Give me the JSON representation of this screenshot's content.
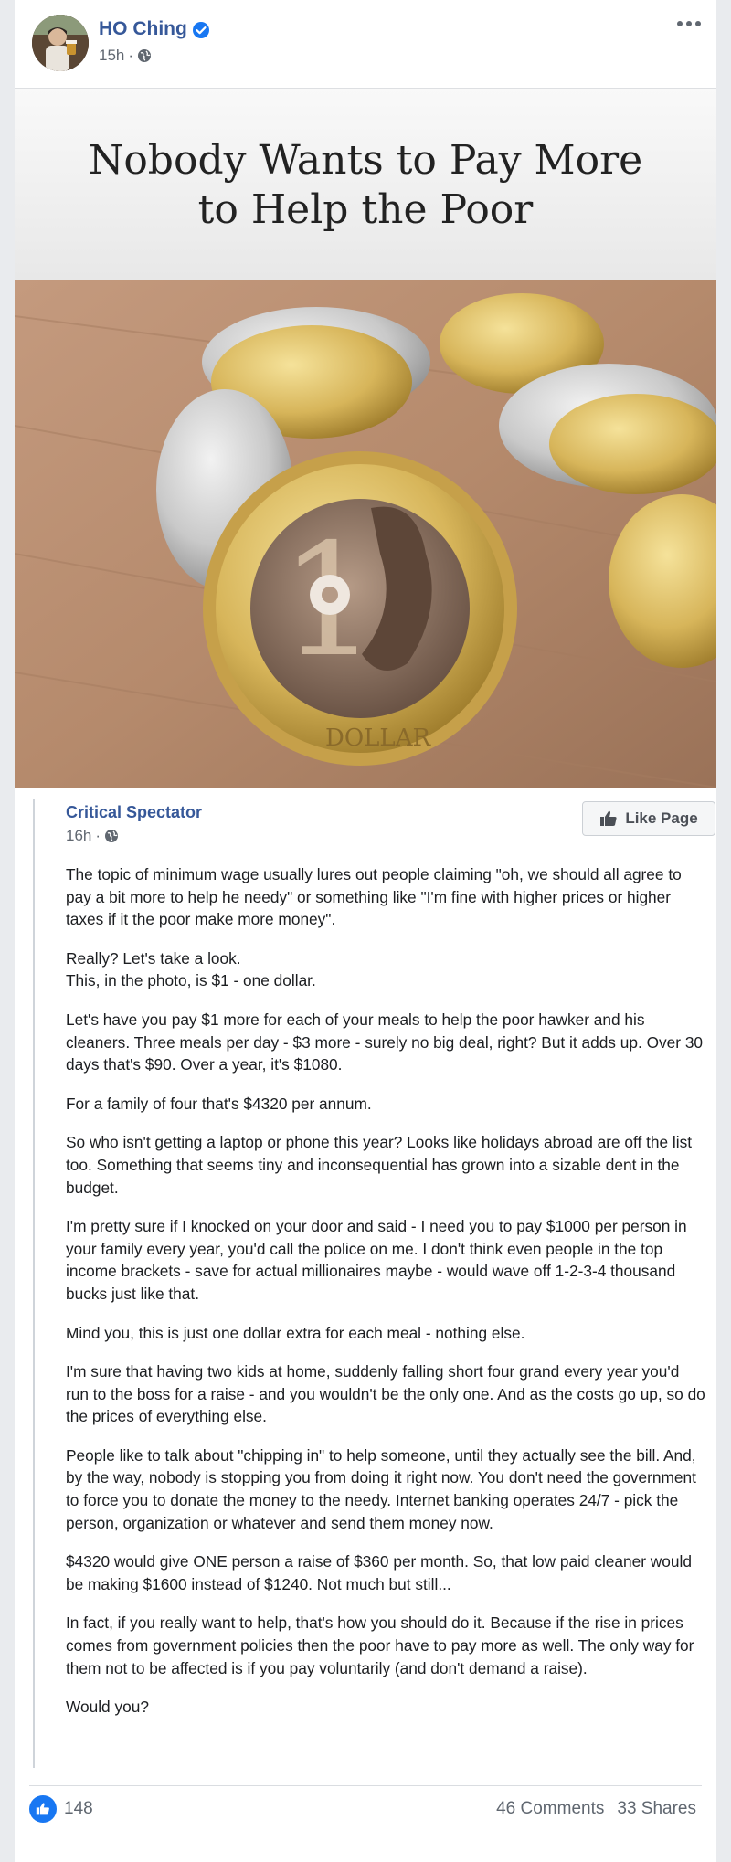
{
  "post": {
    "author": "HO Ching",
    "time": "15h",
    "menu_icon": "more-options-icon"
  },
  "image": {
    "headline_line1": "Nobody Wants to Pay More",
    "headline_line2": "to Help the Poor",
    "coin_text": "DOLLAR",
    "coin_numeral": "1"
  },
  "shared": {
    "page_name": "Critical Spectator",
    "time": "16h",
    "like_page_label": "Like Page",
    "paragraphs": [
      "The topic of minimum wage usually lures out people claiming \"oh, we should all agree to pay a bit more to help he needy\" or something like \"I'm fine with higher prices or higher taxes if it the poor make more money\".",
      "Really? Let's take a look.\nThis, in the photo, is $1 - one dollar.",
      "Let's have you pay $1 more for each of your meals to help the poor hawker and his cleaners. Three meals per day - $3 more - surely no big deal, right? But it adds up. Over 30 days that's $90. Over a year, it's $1080.",
      "For a family of four that's $4320 per annum.",
      "So who isn't getting a laptop or phone this year? Looks like holidays abroad are off the list too. Something that seems tiny and inconsequential has grown into a sizable dent in the budget.",
      "I'm pretty sure if I knocked on your door and said - I need you to pay $1000 per person in your family every year, you'd call the police on me. I don't think even people in the top income brackets - save for actual millionaires maybe - would wave off 1-2-3-4 thousand bucks just like that.",
      "Mind you, this is just one dollar extra for each meal - nothing else.",
      "I'm sure that having two kids at home, suddenly falling short four grand every year you'd run to the boss for a raise - and you wouldn't be the only one. And as the costs go up, so do the prices of everything else.",
      "People like to talk about \"chipping in\" to help someone, until they actually see the bill. And, by the way, nobody is stopping you from doing it right now. You don't need the government to force you to donate the money to the needy. Internet banking operates 24/7 - pick the person, organization or whatever and send them money now.",
      "$4320 would give ONE person a raise of $360 per month. So, that low paid cleaner would be making $1600 instead of $1240. Not much but still...",
      "In fact, if you really want to help, that's how you should do it. Because if the rise in prices comes from government policies then the poor have to pay more as well. The only way for them not to be affected is if you pay voluntarily (and don't demand a raise).",
      "Would you?"
    ]
  },
  "stats": {
    "likes": "148",
    "comments": "46 Comments",
    "shares": "33 Shares"
  },
  "colors": {
    "link": "#365899",
    "meta": "#606770",
    "like_blue": "#1877f2",
    "verified": "#1877f2"
  }
}
